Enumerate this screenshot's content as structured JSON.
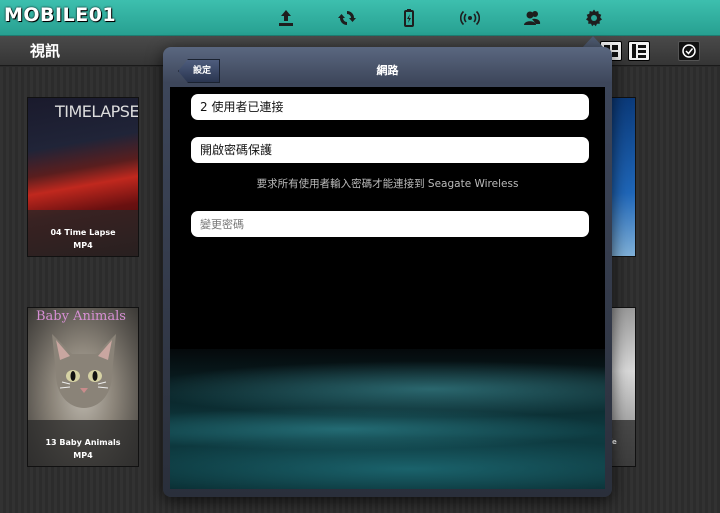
{
  "app": {
    "logo_text": "MOBILE01"
  },
  "toolbar": {
    "icons": [
      "upload-icon",
      "sync-icon",
      "battery-icon",
      "wireless-icon",
      "users-icon",
      "gear-icon"
    ],
    "accent_color": "#2fae9e"
  },
  "subheader": {
    "title": "視訊"
  },
  "tiles": [
    {
      "name": "04 Time Lapse",
      "format": "MP4",
      "artwork_text": "TIMELAPSE"
    },
    {
      "name": "13 Baby Animals",
      "format": "MP4",
      "artwork_text": "Baby Animals"
    },
    {
      "name_fragment": "fe"
    }
  ],
  "modal": {
    "title": "網路",
    "back_label": "設定",
    "connected_users": "2 使用者已連接",
    "password_toggle_label": "開啟密碼保護",
    "password_hint": "要求所有使用者輸入密碼才能連接到 Seagate Wireless",
    "change_password_placeholder": "變更密碼"
  }
}
